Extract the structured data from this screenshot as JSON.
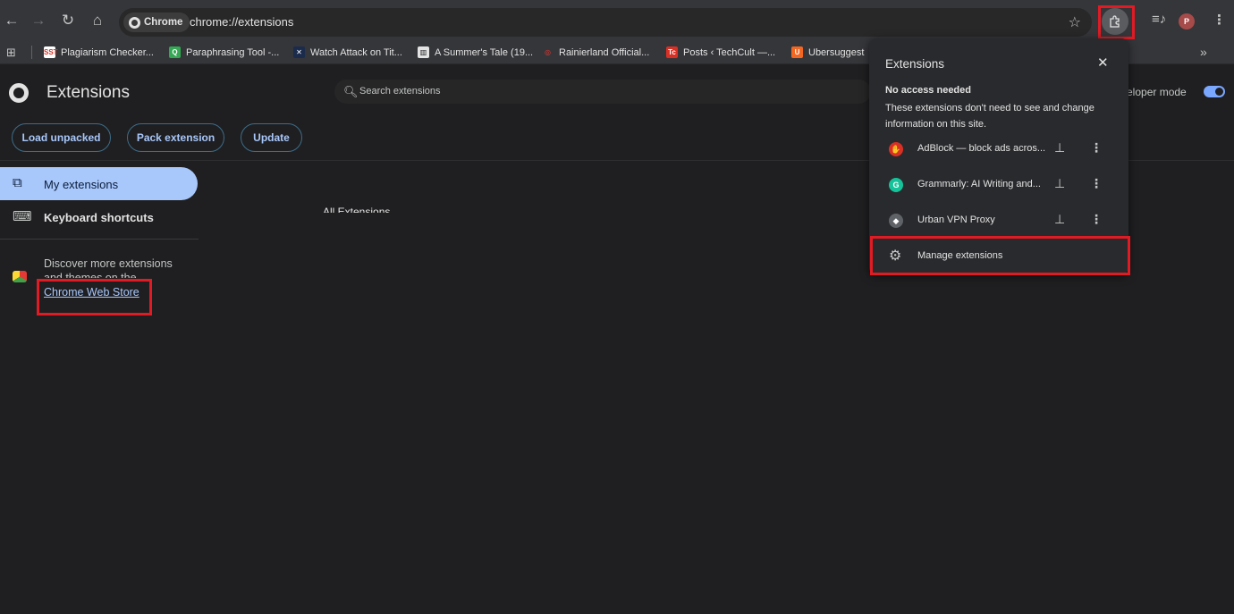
{
  "browser": {
    "chip_label": "Chrome",
    "url": "chrome://extensions",
    "profile_initial": "P"
  },
  "bookmarks": [
    {
      "label": "Plagiarism Checker...",
      "favicon_text": "SST",
      "color": "#ffffff",
      "text_color": "#d93025"
    },
    {
      "label": "Paraphrasing Tool -...",
      "favicon_text": "Q",
      "color": "#34a853",
      "text_color": "#ffffff"
    },
    {
      "label": "Watch Attack on Tit...",
      "favicon_text": "✕",
      "color": "#1a2b4c",
      "text_color": "#ffffff"
    },
    {
      "label": "A Summer's Tale (19...",
      "favicon_text": "▥",
      "color": "#e3e3e3",
      "text_color": "#202124"
    },
    {
      "label": "Rainierland Official...",
      "favicon_text": "◎",
      "color": "#35363a",
      "text_color": "#e53935"
    },
    {
      "label": "Posts ‹ TechCult —...",
      "favicon_text": "Tc",
      "color": "#d93025",
      "text_color": "#ffffff"
    },
    {
      "label": "Ubersuggest",
      "favicon_text": "U",
      "color": "#f26722",
      "text_color": "#ffffff"
    }
  ],
  "page": {
    "title": "Extensions",
    "search_placeholder": "Search extensions",
    "developer_mode_label": "eloper mode",
    "developer_mode_on": true,
    "buttons": {
      "load_unpacked": "Load unpacked",
      "pack_extension": "Pack extension",
      "update": "Update"
    },
    "all_extensions_heading": "All Extensions"
  },
  "sidebar": {
    "my_extensions": "My extensions",
    "keyboard_shortcuts": "Keyboard shortcuts",
    "discover_line1": "Discover more extensions",
    "discover_line2": "and themes on the",
    "store_link": "Chrome Web Store"
  },
  "popup": {
    "title": "Extensions",
    "no_access_title": "No access needed",
    "no_access_desc": "These extensions don't need to see and change information on this site.",
    "extensions": [
      {
        "name": "AdBlock — block ads acros...",
        "icon_color": "#d93025",
        "icon_text": "✋"
      },
      {
        "name": "Grammarly: AI Writing and...",
        "icon_color": "#15c39a",
        "icon_text": "G"
      },
      {
        "name": "Urban VPN Proxy",
        "icon_color": "#5f6368",
        "icon_text": "◆"
      }
    ],
    "manage_label": "Manage extensions"
  },
  "colors": {
    "accent": "#a8c7fa",
    "highlight_box": "#e01b24",
    "background": "#1f1f21"
  }
}
